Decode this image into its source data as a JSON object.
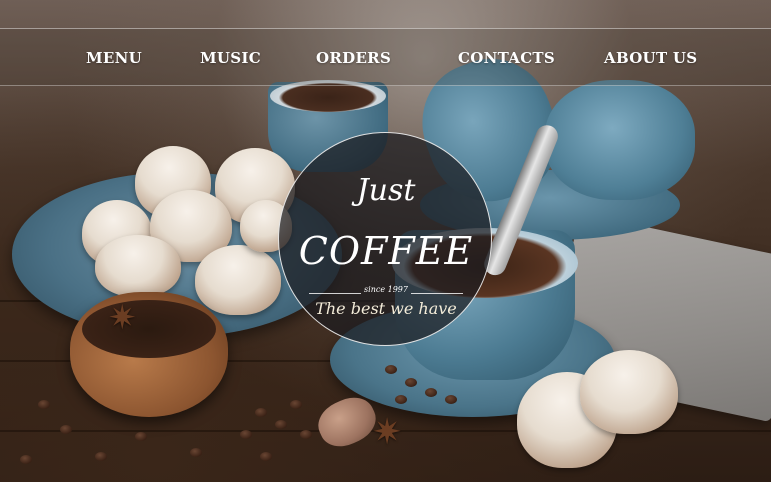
{
  "nav": {
    "items": [
      {
        "label": "MENU"
      },
      {
        "label": "MUSIC"
      },
      {
        "label": "ORDERS"
      },
      {
        "label": "CONTACTS"
      },
      {
        "label": "ABOUT US"
      }
    ]
  },
  "logo": {
    "line1": "Just",
    "line2": "COFFEE",
    "since": "since 1997",
    "tagline": "The best we have"
  },
  "hero": {
    "background_icon": "coffee-scene-photo"
  }
}
